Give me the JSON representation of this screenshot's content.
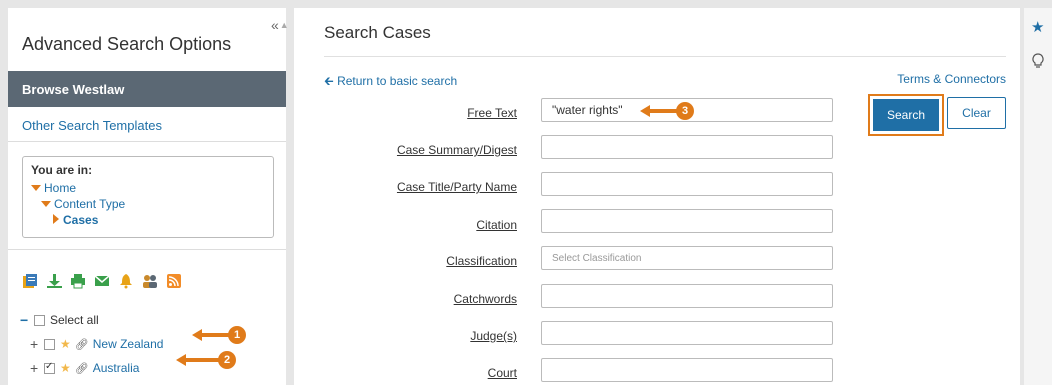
{
  "sidebar": {
    "title": "Advanced Search Options",
    "collapse_icon": "«",
    "browse_label": "Browse Westlaw",
    "other_templates": "Other Search Templates",
    "you_are_in_label": "You are in:",
    "crumbs": [
      "Home",
      "Content Type",
      "Cases"
    ],
    "toolbar_icons": [
      "folder-icon",
      "download-icon",
      "print-icon",
      "email-icon",
      "alert-icon",
      "share-icon",
      "rss-icon"
    ],
    "select_all": "Select all",
    "jurisdictions": [
      {
        "label": "New Zealand",
        "checked": false
      },
      {
        "label": "Australia",
        "checked": true
      }
    ]
  },
  "callouts": [
    "1",
    "2",
    "3"
  ],
  "main": {
    "title": "Search Cases",
    "return_link": "Return to basic search",
    "terms_link": "Terms & Connectors",
    "search_label": "Search",
    "clear_label": "Clear",
    "fields": [
      {
        "label": "Free Text",
        "value": "\"water rights\""
      },
      {
        "label": "Case Summary/Digest",
        "value": ""
      },
      {
        "label": "Case Title/Party Name",
        "value": ""
      },
      {
        "label": "Citation",
        "value": ""
      },
      {
        "label": "Classification",
        "placeholder": "Select Classification"
      },
      {
        "label": "Catchwords",
        "value": ""
      },
      {
        "label": "Judge(s)",
        "value": ""
      },
      {
        "label": "Court",
        "value": ""
      }
    ]
  },
  "colors": {
    "accent": "#1f6fa6",
    "callout": "#e07b1a",
    "browse_bg": "#5b6874"
  }
}
